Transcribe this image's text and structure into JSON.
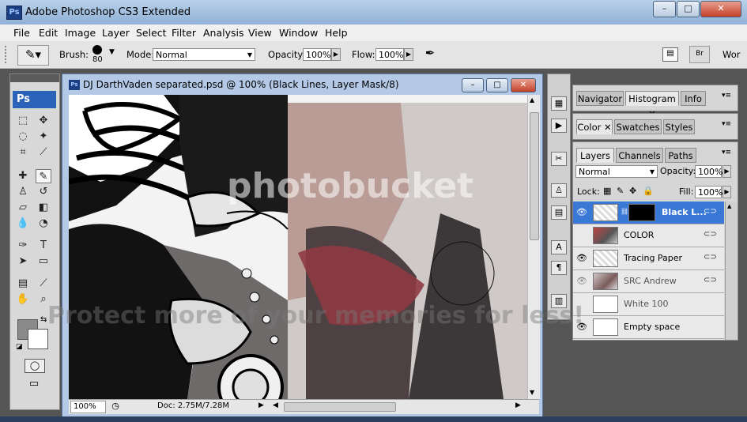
{
  "app": {
    "title": "Adobe Photoshop CS3 Extended",
    "icon_label": "Ps",
    "window_controls": {
      "minimize": "–",
      "maximize": "□",
      "close": "✕"
    }
  },
  "menu": [
    "File",
    "Edit",
    "Image",
    "Layer",
    "Select",
    "Filter",
    "Analysis",
    "View",
    "Window",
    "Help"
  ],
  "options_bar": {
    "brush_label": "Brush:",
    "brush_size": "80",
    "mode_label": "Mode:",
    "mode_value": "Normal",
    "opacity_label": "Opacity:",
    "opacity_value": "100%",
    "flow_label": "Flow:",
    "flow_value": "100%",
    "workspace_label": "Wor"
  },
  "tools": {
    "logo": "Ps"
  },
  "document": {
    "title": "DJ DarthVaden separated.psd @ 100% (Black Lines, Layer Mask/8)",
    "icon_label": "Ps",
    "zoom": "100%",
    "doc_size": "Doc: 2.75M/7.28M"
  },
  "panels": {
    "group1_tabs": [
      "Navigator",
      "Histogram",
      "Info"
    ],
    "group2_tabs": [
      "Color",
      "Swatches",
      "Styles"
    ],
    "group3_tabs": [
      "Layers",
      "Channels",
      "Paths"
    ],
    "blend_mode": "Normal",
    "opacity_label": "Opacity:",
    "opacity_value": "100%",
    "lock_label": "Lock:",
    "fill_label": "Fill:",
    "fill_value": "100%"
  },
  "layers": [
    {
      "name": "Black L...",
      "visible": true,
      "selected": true
    },
    {
      "name": "COLOR",
      "visible": false,
      "selected": false
    },
    {
      "name": "Tracing Paper",
      "visible": true,
      "selected": false
    },
    {
      "name": "SRC Andrew",
      "visible": true,
      "selected": false
    },
    {
      "name": "White 100",
      "visible": false,
      "selected": false
    },
    {
      "name": "Empty space",
      "visible": true,
      "selected": false
    }
  ],
  "watermark": {
    "line1": "photobucket",
    "line2": "Protect more of your memories for less!"
  },
  "colors": {
    "selection": "#3a78d6",
    "title_bar": "#b9d1ea",
    "close_button": "#c4412b"
  }
}
